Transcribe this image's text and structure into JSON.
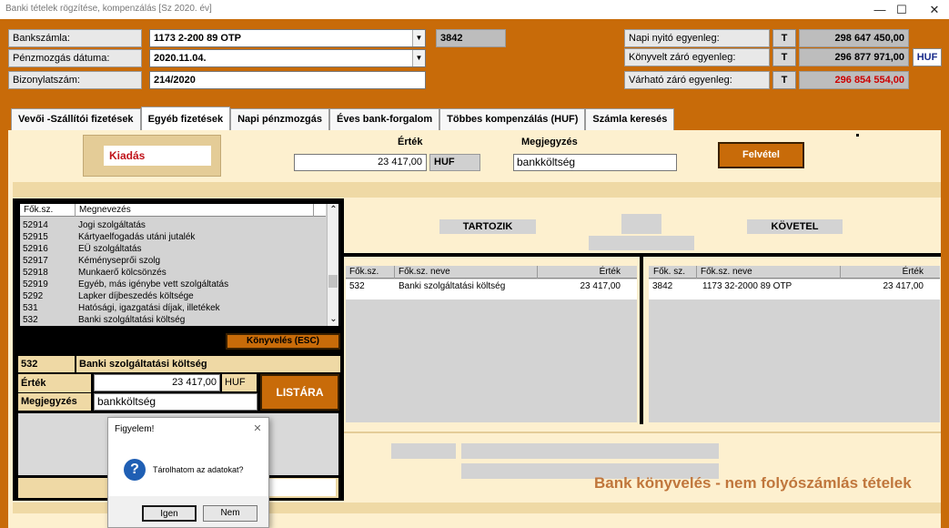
{
  "window": {
    "title": "Banki tételek rögzítése, kompenzálás  [Sz                   2020. év]",
    "minimize": "—",
    "maximize": "☐",
    "close": "✕"
  },
  "header": {
    "bankszamla_label": "Bankszámla:",
    "bankszamla_value": "1173    2-200      89 OTP",
    "bankszamla_code": "3842",
    "penzmozgas_label": "Pénzmozgás dátuma:",
    "penzmozgas_value": "2020.11.04.",
    "bizonylat_label": "Bizonylatszám:",
    "bizonylat_value": "214/2020",
    "napi_nyito_label": "Napi nyitó egyenleg:",
    "napi_nyito_t": "T",
    "napi_nyito_value": "298 647 450,00",
    "konyvelt_zaro_label": "Könyvelt záró egyenleg:",
    "konyvelt_zaro_t": "T",
    "konyvelt_zaro_value": "296 877 971,00",
    "currency": "HUF",
    "varhato_zaro_label": "Várható záró egyenleg:",
    "varhato_zaro_t": "T",
    "varhato_zaro_value": "296 854 554,00",
    "dropdown_glyph": "▼"
  },
  "tabs": [
    {
      "label": "Vevői -Szállítói fizetések"
    },
    {
      "label": "Egyéb fizetések"
    },
    {
      "label": "Napi pénzmozgás"
    },
    {
      "label": "Éves bank-forgalom"
    },
    {
      "label": "Többes kompenzálás (HUF)"
    },
    {
      "label": "Számla keresés"
    }
  ],
  "entry": {
    "type_label": "Kiadás",
    "ertek_label": "Érték",
    "ertek_value": "23 417,00",
    "ertek_currency": "HUF",
    "megjegyzes_label": "Megjegyzés",
    "megjegyzes_value": "bankköltség",
    "felvetel_button": "Felvétel"
  },
  "account_list": {
    "col_fokonyv": "Fők.sz.",
    "col_megnevezes": "Megnevezés",
    "rows": [
      {
        "code": "52914",
        "name": "Jogi szolgáltatás"
      },
      {
        "code": "52915",
        "name": "Kártyaelfogadás utáni jutalék"
      },
      {
        "code": "52916",
        "name": "EÜ szolgáltatás"
      },
      {
        "code": "52917",
        "name": "Kéményseprői szolg"
      },
      {
        "code": "52918",
        "name": "Munkaerő kölcsönzés"
      },
      {
        "code": "52919",
        "name": "Egyéb, más igénybe vett szolgáltatás"
      },
      {
        "code": "5292",
        "name": "Lapker díjbeszedés költsége"
      },
      {
        "code": "531",
        "name": "Hatósági, igazgatási díjak, illetékek"
      },
      {
        "code": "532",
        "name": "Banki szolgáltatási költség"
      }
    ],
    "scroll_up": "⌃",
    "scroll_down": "⌄",
    "konyveles_button": "Könyvelés (ESC)"
  },
  "selected": {
    "code": "532",
    "name": "Banki szolgáltatási költség",
    "ertek_label": "Érték",
    "ertek_value": "23 417,00",
    "currency": "HUF",
    "megjegyzes_label": "Megjegyzés",
    "megjegyzes_value": "bankköltség",
    "listara_button": "LISTÁRA"
  },
  "tartozik": {
    "title": "TARTOZIK",
    "col_fokonyv": "Fők.sz.",
    "col_name": "Fők.sz. neve",
    "col_ertek": "Érték",
    "rows": [
      {
        "code": "532",
        "name": "Banki szolgáltatási költség",
        "value": "23 417,00"
      }
    ]
  },
  "kovetel": {
    "title": "KÖVETEL",
    "col_fokonyv": "Fők. sz.",
    "col_name": "Fők.sz. neve",
    "col_ertek": "Érték",
    "rows": [
      {
        "code": "3842",
        "name": "1173     32-2000      89 OTP",
        "value": "23 417,00"
      }
    ]
  },
  "footer_caption": "Bank könyvelés - nem folyószámlás tételek",
  "dialog": {
    "title": "Figyelem!",
    "close": "✕",
    "icon": "?",
    "message": "Tárolhatom az adatokat?",
    "yes": "Igen",
    "no": "Nem"
  },
  "colors": {
    "header_bg": "#c86b09",
    "panel_bg": "#fdf0cf",
    "red_value": "#cc0000",
    "caption_color": "#c0763c"
  }
}
